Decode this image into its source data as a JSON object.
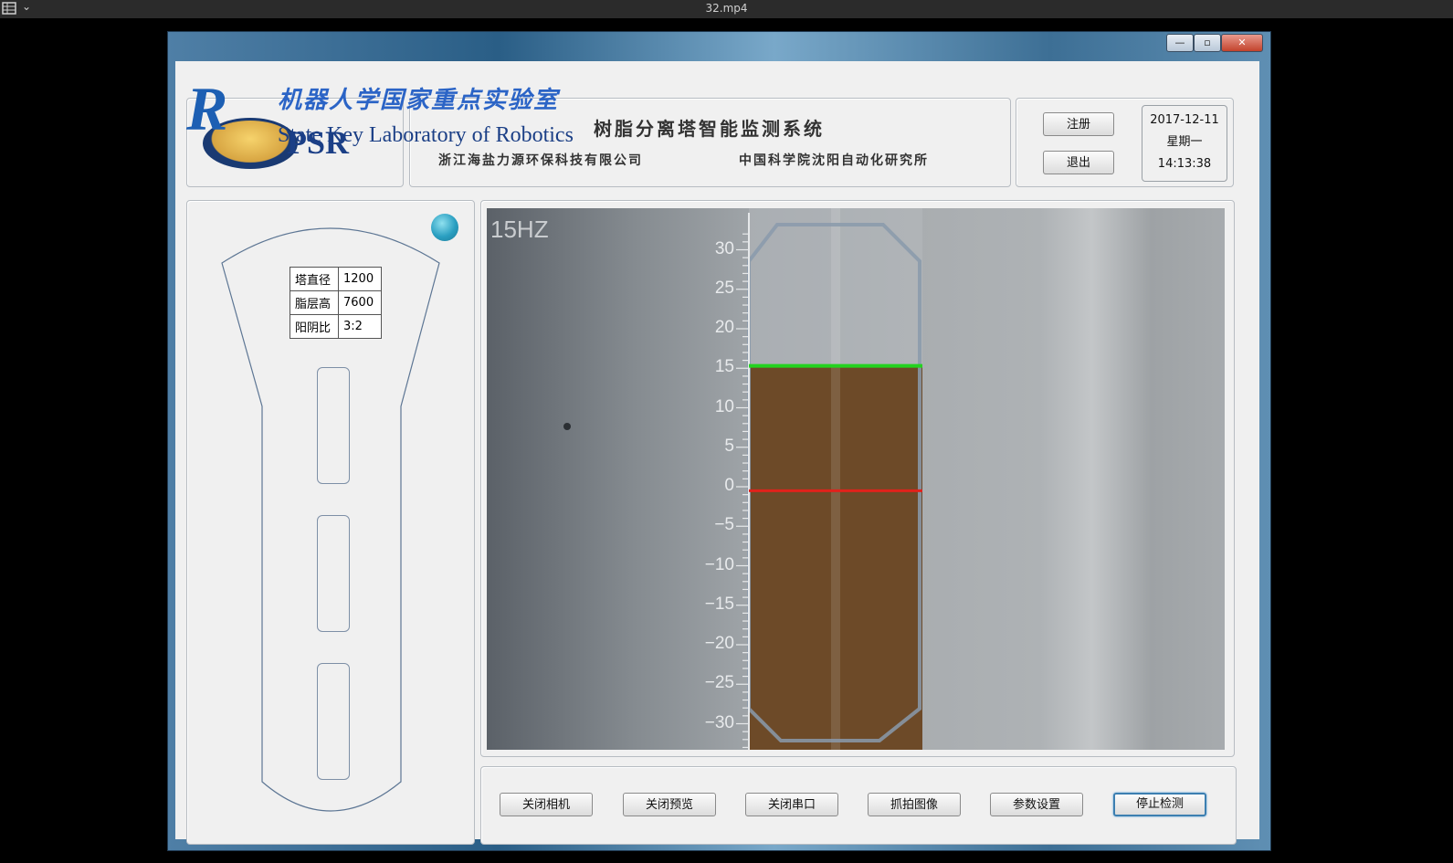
{
  "player": {
    "title": "32.mp4",
    "menu_icon": "film-strip-icon",
    "chevron": "⌄"
  },
  "window": {
    "controls": {
      "minimize": "—",
      "maximize": "▫",
      "close": "✕"
    }
  },
  "header": {
    "logo": {
      "letter": "R",
      "brand": "PSR",
      "cn": "机器人学国家重点实验室",
      "en": "State Key Laboratory of Robotics"
    },
    "system_title": "树脂分离塔智能监测系统",
    "company_left": "浙江海盐力源环保科技有限公司",
    "company_right": "中国科学院沈阳自动化研究所",
    "register_label": "注册",
    "exit_label": "退出",
    "date": "2017-12-11",
    "weekday": "星期一",
    "time": "14:13:38"
  },
  "params": [
    {
      "label": "塔直径",
      "value": "1200"
    },
    {
      "label": "脂层高",
      "value": "7600"
    },
    {
      "label": "阳阴比",
      "value": "3:2"
    }
  ],
  "camera": {
    "label": "15HZ",
    "scale_labels": [
      "30",
      "25",
      "20",
      "15",
      "10",
      "5",
      "0",
      "−5",
      "−10",
      "−15",
      "−20",
      "−25",
      "−30"
    ],
    "green_line_level": 15.3,
    "red_line_level": -0.5,
    "colors": {
      "green_line": "#23d31f",
      "red_line": "#e2211b",
      "resin": "#6d4a28"
    }
  },
  "controls": {
    "close_camera": "关闭相机",
    "close_preview": "关闭预览",
    "close_serial": "关闭串口",
    "capture_image": "抓拍图像",
    "param_settings": "参数设置",
    "stop_detection": "停止检测"
  }
}
